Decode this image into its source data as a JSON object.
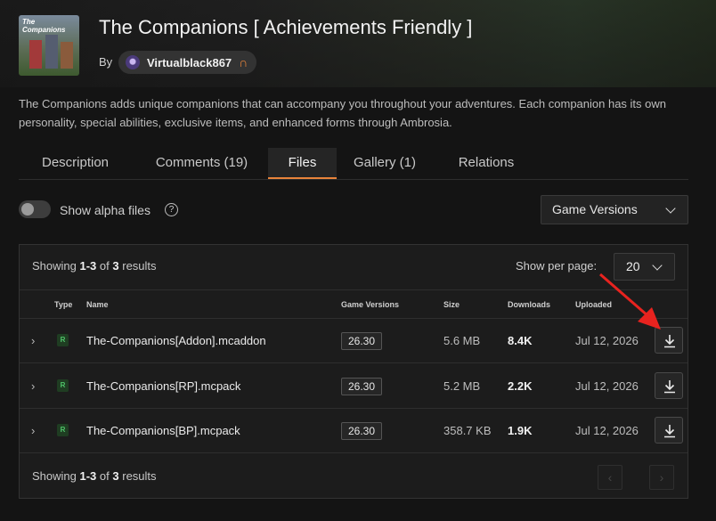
{
  "header": {
    "title": "The Companions [ Achievements Friendly ]",
    "by_label": "By",
    "author": "Virtualblack867",
    "author_badge": "∩",
    "thumbnail_text": "The Companions"
  },
  "description": "The Companions adds unique companions that can accompany you throughout your adventures. Each companion has its own personality, special abilities, exclusive items, and enhanced forms through Ambrosia.",
  "tabs": [
    {
      "label": "Description",
      "active": false
    },
    {
      "label": "Comments (19)",
      "active": false
    },
    {
      "label": "Files",
      "active": true
    },
    {
      "label": "Gallery (1)",
      "active": false
    },
    {
      "label": "Relations",
      "active": false
    }
  ],
  "filters": {
    "alpha_label": "Show alpha files",
    "alpha_enabled": false,
    "help_glyph": "?",
    "game_versions_label": "Game Versions"
  },
  "files_panel": {
    "showing_prefix": "Showing",
    "showing_range": "1-3",
    "showing_of": "of",
    "showing_total": "3",
    "showing_suffix": "results",
    "per_page_label": "Show per page:",
    "per_page_value": "20",
    "columns": {
      "type": "Type",
      "name": "Name",
      "game_versions": "Game Versions",
      "size": "Size",
      "downloads": "Downloads",
      "uploaded": "Uploaded"
    },
    "rows": [
      {
        "type": "R",
        "name": "The-Companions[Addon].mcaddon",
        "version": "26.30",
        "size": "5.6 MB",
        "downloads": "8.4K",
        "uploaded": "Jul 12, 2026"
      },
      {
        "type": "R",
        "name": "The-Companions[RP].mcpack",
        "version": "26.30",
        "size": "5.2 MB",
        "downloads": "2.2K",
        "uploaded": "Jul 12, 2026"
      },
      {
        "type": "R",
        "name": "The-Companions[BP].mcpack",
        "version": "26.30",
        "size": "358.7 KB",
        "downloads": "1.9K",
        "uploaded": "Jul 12, 2026"
      }
    ],
    "pagination": {
      "prev": "‹",
      "next": "›"
    }
  },
  "colors": {
    "accent": "#e8843a",
    "annotation_arrow": "#e8231f",
    "release_badge": "#4fc46a"
  }
}
